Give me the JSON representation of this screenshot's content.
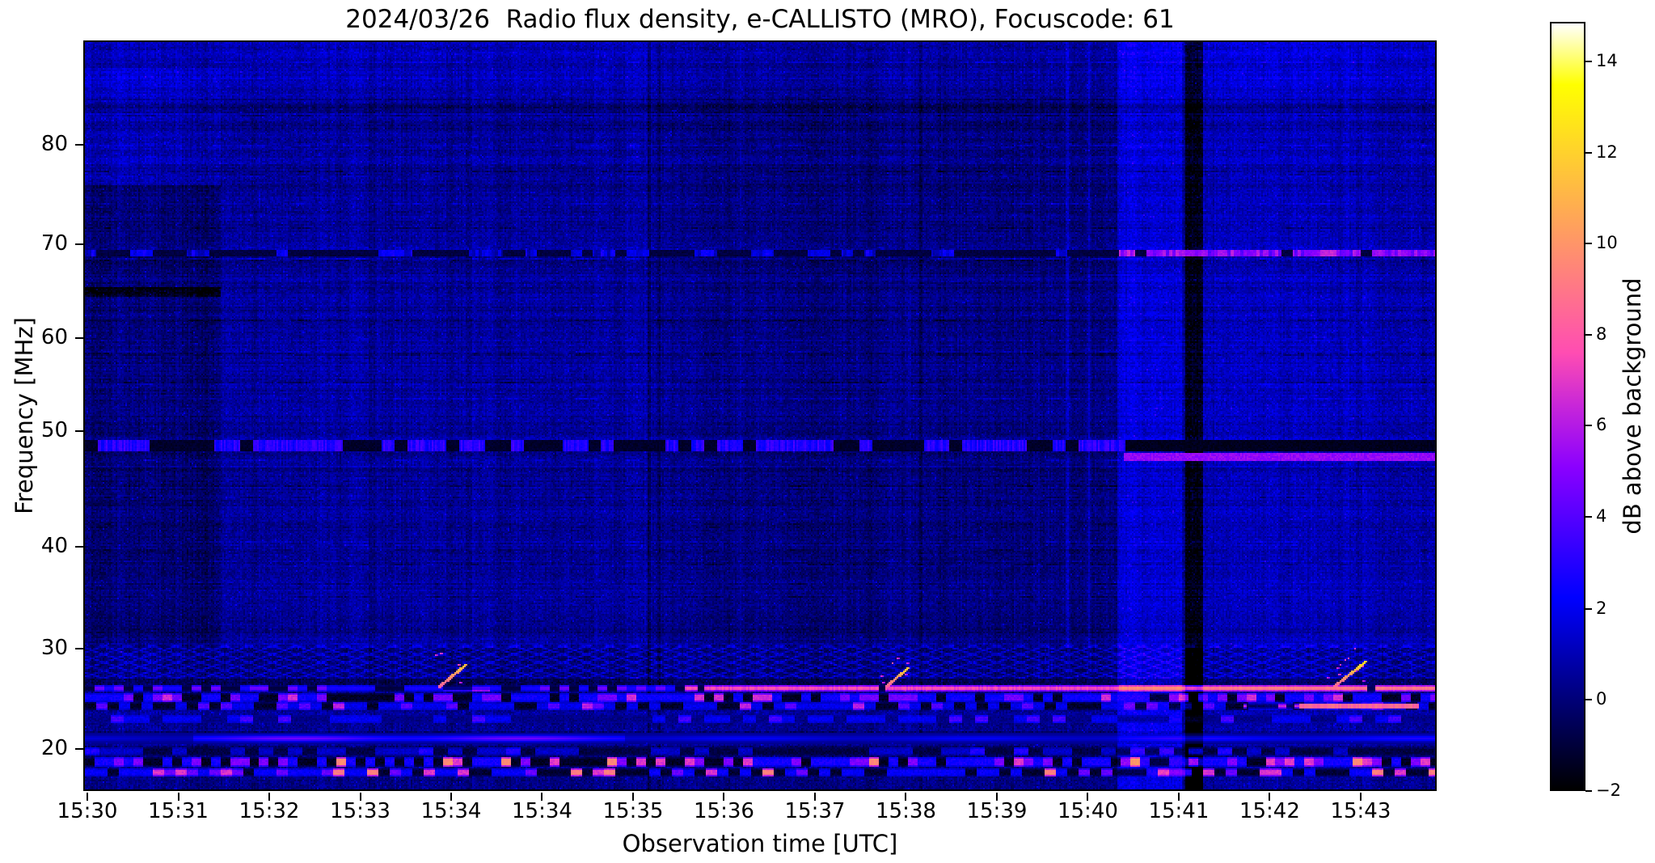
{
  "title": "2024/03/26  Radio flux density, e-CALLISTO (MRO), Focuscode: 61",
  "axes": {
    "xlabel": "Observation time [UTC]",
    "ylabel": "Frequency [MHz]",
    "x_ticks": [
      {
        "label": "15:30",
        "pos": 0.003
      },
      {
        "label": "15:31",
        "pos": 0.0702
      },
      {
        "label": "15:32",
        "pos": 0.1374
      },
      {
        "label": "15:33",
        "pos": 0.2046
      },
      {
        "label": "15:34",
        "pos": 0.2718
      },
      {
        "label": "15:34",
        "pos": 0.339
      },
      {
        "label": "15:35",
        "pos": 0.4062
      },
      {
        "label": "15:36",
        "pos": 0.4734
      },
      {
        "label": "15:37",
        "pos": 0.5406
      },
      {
        "label": "15:38",
        "pos": 0.6078
      },
      {
        "label": "15:39",
        "pos": 0.675
      },
      {
        "label": "15:40",
        "pos": 0.7422
      },
      {
        "label": "15:41",
        "pos": 0.8094
      },
      {
        "label": "15:42",
        "pos": 0.8766
      },
      {
        "label": "15:43",
        "pos": 0.9438
      }
    ],
    "y_ticks": [
      {
        "label": "80",
        "pos": 0.139
      },
      {
        "label": "70",
        "pos": 0.2716
      },
      {
        "label": "60",
        "pos": 0.3966
      },
      {
        "label": "50",
        "pos": 0.5205
      },
      {
        "label": "40",
        "pos": 0.6746
      },
      {
        "label": "30",
        "pos": 0.8103
      },
      {
        "label": "20",
        "pos": 0.944
      }
    ]
  },
  "colorbar": {
    "label": "dB above background",
    "vmin": -2,
    "vmax": 14.86,
    "colormap": "gnuplot2",
    "stops": [
      [
        0,
        "#000000"
      ],
      [
        0.125,
        "#000080"
      ],
      [
        0.25,
        "#0000ff"
      ],
      [
        0.35,
        "#5000ff"
      ],
      [
        0.42,
        "#8a00ff"
      ],
      [
        0.5,
        "#c726d9"
      ],
      [
        0.57,
        "#ff4db2"
      ],
      [
        0.65,
        "#ff7589"
      ],
      [
        0.75,
        "#ffa855"
      ],
      [
        0.85,
        "#ffdb23"
      ],
      [
        0.92,
        "#ffff00"
      ],
      [
        1,
        "#ffffff"
      ]
    ],
    "ticks": [
      {
        "label": "14",
        "pos": 0.051
      },
      {
        "label": "12",
        "pos": 0.17
      },
      {
        "label": "10",
        "pos": 0.288
      },
      {
        "label": "8",
        "pos": 0.407
      },
      {
        "label": "6",
        "pos": 0.525
      },
      {
        "label": "4",
        "pos": 0.644
      },
      {
        "label": "2",
        "pos": 0.763
      },
      {
        "label": "0",
        "pos": 0.881
      },
      {
        "label": "−2",
        "pos": 1.0
      }
    ]
  },
  "chart_data": {
    "type": "heatmap",
    "subtype": "radio-spectrogram",
    "title": "2024/03/26  Radio flux density, e-CALLISTO (MRO), Focuscode: 61",
    "date": "2024/03/26",
    "instrument": "e-CALLISTO (MRO)",
    "focuscode": 61,
    "xlabel": "Observation time [UTC]",
    "ylabel": "Frequency [MHz]",
    "x_range": [
      "15:30",
      "15:44"
    ],
    "y_range_mhz": [
      16.2,
      88.5
    ],
    "value_label": "dB above background",
    "value_range_db": [
      -2,
      15
    ],
    "x_tick_labels": [
      "15:30",
      "15:31",
      "15:32",
      "15:33",
      "15:34",
      "15:34",
      "15:35",
      "15:36",
      "15:37",
      "15:38",
      "15:39",
      "15:40",
      "15:41",
      "15:42",
      "15:43"
    ],
    "y_tick_values_mhz": [
      80,
      70,
      60,
      50,
      40,
      30,
      20
    ],
    "colorbar_tick_values_db": [
      14,
      12,
      10,
      8,
      6,
      4,
      2,
      0,
      -2
    ],
    "legend_position": "right-colorbar",
    "grid": false,
    "notable_features": [
      "Persistent narrow-band RFI line near 25.9 MHz; dashed before ~15:36, brightens to ~9–10.5 dB (orange) after ~15:36 and strongest after ~15:41",
      "Short upward-drifting bursts rising from the 26 MHz line near 15:34, 15:38.8 and 15:43.8 (up to ~13 dB)",
      "Dashed bright-blue RFI lane at ~48.6 MHz; becomes a solid dark lane with a bright violet sub-line after ~15:41",
      "Intermittent RFI line at ~69.3 MHz, dark with dashes on the left, bright violet dashes after ~15:41",
      "Receiver level step at ~15:31.5 (left segment darker 30–76 MHz, brighter 76–86 MHz)",
      "Bright vertical band ~15:40.8–15:41.2 followed by a near-black dropout stripe ~15:41.3",
      "Herringbone interference pattern 27–30 MHz; dash/morse RFI bands at 17–25.5 MHz; smooth glowing line near 20.8 MHz strongest 15:31–15:35",
      "Dark RFI notch at ~65 MHz visible only before 15:31.5; pink/salmon dash line near 24 MHz around 15:42.5–15:44"
    ],
    "render_model": {
      "seed": 7,
      "base_level": 0.35,
      "noise": {
        "pixel": 1.15,
        "col": [
          0.5,
          0.35,
          0.3
        ],
        "row_hi": 0.55,
        "row_lo": 0.18,
        "streak_prob": 0.2,
        "streak_amp": 2.2,
        "speckle_prob": 0.015,
        "speckle_add": 1.1
      },
      "freq_anchors": [
        [
          0,
          88.5
        ],
        [
          0.139,
          80
        ],
        [
          0.2716,
          70
        ],
        [
          0.3966,
          60
        ],
        [
          0.5205,
          50
        ],
        [
          0.6746,
          40
        ],
        [
          0.8103,
          30
        ],
        [
          0.944,
          20
        ],
        [
          1,
          16.2
        ]
      ],
      "boxes": [
        {
          "f": [
            30,
            76
          ],
          "t": [
            0,
            0.1
          ],
          "dv": -0.55
        },
        {
          "f": [
            76,
            86.5
          ],
          "t": [
            0,
            0.1
          ],
          "dv": 0.45
        },
        {
          "f": [
            30,
            88.5
          ],
          "t": [
            0.1,
            0.418
          ],
          "dv": 0.12
        },
        {
          "f": [
            30,
            88.5
          ],
          "t": [
            0.43,
            0.765
          ],
          "dv": -0.28
        },
        {
          "f": [
            15.9,
            88.5
          ],
          "t": [
            0.765,
            0.8125
          ],
          "dv": 1.1
        },
        {
          "f": [
            15.9,
            88.5
          ],
          "t": [
            0.8145,
            0.8275
          ],
          "dv": -1.9
        },
        {
          "f": [
            30,
            88.5
          ],
          "t": [
            0.8285,
            1
          ],
          "dv": 0.55
        },
        {
          "f": [
            15.9,
            30
          ],
          "t": [
            0.8285,
            1
          ],
          "dv": 0.3
        },
        {
          "f": [
            15.9,
            88.5
          ],
          "t": [
            0.417,
            0.4195
          ],
          "dv": -1.0
        },
        {
          "f": [
            15.9,
            88.5
          ],
          "t": [
            0.424,
            0.426
          ],
          "dv": -0.7
        },
        {
          "f": [
            15.9,
            88.5
          ],
          "t": [
            0.6175,
            0.6195
          ],
          "dv": -0.6
        },
        {
          "f": [
            15.9,
            88.5
          ],
          "t": [
            0.6355,
            0.6375
          ],
          "dv": -0.5
        },
        {
          "f": [
            30,
            88.5
          ],
          "t": [
            0.727,
            0.7285
          ],
          "dv": 0.9
        },
        {
          "f": [
            30,
            88.5
          ],
          "t": [
            0.743,
            0.7445
          ],
          "dv": 0.9
        },
        {
          "f": [
            84,
            88.5
          ],
          "t": [
            0,
            1
          ],
          "dv": 0.5
        },
        {
          "f": [
            64.5,
            65.5
          ],
          "t": [
            0,
            0.1
          ],
          "dv": -1.6
        },
        {
          "f": [
            82.8,
            83.6
          ],
          "t": [
            0,
            1
          ],
          "dv": -0.5
        },
        {
          "f": [
            26.3,
            26.9
          ],
          "t": [
            0,
            1
          ],
          "dv": -1.0
        },
        {
          "f": [
            22.3,
            23.5
          ],
          "t": [
            0,
            1
          ],
          "dv": 0.35
        },
        {
          "f": [
            19.1,
            20.1
          ],
          "t": [
            0,
            1
          ],
          "dv": -0.6
        },
        {
          "f": [
            15.9,
            17.3
          ],
          "t": [
            0,
            1
          ],
          "dv": -0.2
        }
      ],
      "post_boxes": [
        {
          "f": [
            15.9,
            30
          ],
          "t": [
            0.765,
            0.8125
          ],
          "dv": 0.5
        },
        {
          "f": [
            15.9,
            30
          ],
          "t": [
            0.8145,
            0.8275
          ],
          "dv": -1.6
        }
      ],
      "wave": {
        "f": [
          26.9,
          30.3
        ],
        "base": -0.55,
        "amp": 1.7,
        "kx": 0.42,
        "ky": 1.25
      },
      "line69": {
        "f": [
          68.9,
          69.6
        ],
        "base": -1.3,
        "t_split": 0.765,
        "dash_len": 7,
        "fill_left": 0.35,
        "amp_left": 2.6,
        "fill_right": 0.85,
        "amp_right": 6.0
      },
      "line48": {
        "f": [
          48.2,
          49.2
        ],
        "f_sub": [
          47.4,
          48.1
        ],
        "t_solid": 0.77,
        "dash_len": 8,
        "fill": 0.55,
        "dash_v": 2.6,
        "base": -1.65,
        "sub_v": 5.3
      },
      "rfi26": {
        "f": [
          25.55,
          26.25
        ],
        "t_dash": 0.44,
        "t_high": 0.765,
        "v_mid": 8.7,
        "v_high": 10.4,
        "dash_levels": [
          [
            0.3,
            -1.2
          ],
          [
            0.45,
            3.0
          ],
          [
            0.25,
            5.2
          ]
        ]
      },
      "bursts": [
        {
          "t": 0.262,
          "dx": 16,
          "dy": 13,
          "v": 12,
          "speckles": 5
        },
        {
          "t": 0.592,
          "dx": 13,
          "dy": 11,
          "v": 12.5,
          "speckles": 7
        },
        {
          "t": 0.925,
          "dx": 19,
          "dy": 15,
          "v": 13,
          "speckles": 10
        }
      ],
      "hlines": [
        {
          "f": [
            25.55,
            26.1
          ],
          "t": [
            0.265,
            0.3
          ],
          "v": 8.2
        },
        {
          "f": [
            23.8,
            24.25
          ],
          "t": [
            0.9,
            0.988
          ],
          "v": 8.4
        }
      ],
      "dashbands": [
        {
          "f": [
            24.5,
            25.45
          ],
          "t": [
            0,
            1
          ],
          "len": 6,
          "levels": [
            [
              0.3,
              -1.4
            ],
            [
              0.4,
              2.4
            ],
            [
              0.2,
              4.6
            ],
            [
              0.1,
              6.6
            ]
          ]
        },
        {
          "f": [
            23.6,
            24.4
          ],
          "t": [
            0,
            1
          ],
          "len": 7,
          "levels": [
            [
              0.35,
              -1.3
            ],
            [
              0.45,
              1.9
            ],
            [
              0.15,
              4.0
            ],
            [
              0.05,
              6.2
            ]
          ]
        },
        {
          "f": [
            23.8,
            24.3
          ],
          "t": [
            0.858,
            0.9
          ],
          "len": 5,
          "levels": [
            [
              0.5,
              -0.5
            ],
            [
              0.5,
              6.6
            ]
          ]
        },
        {
          "f": [
            22.4,
            23.1
          ],
          "t": [
            0,
            1
          ],
          "len": 8,
          "levels": [
            [
              0.45,
              0.2
            ],
            [
              0.4,
              2.0
            ],
            [
              0.15,
              3.6
            ]
          ]
        },
        {
          "f": [
            19.2,
            19.9
          ],
          "t": [
            0,
            1
          ],
          "len": 9,
          "levels": [
            [
              0.55,
              -0.9
            ],
            [
              0.35,
              1.3
            ],
            [
              0.1,
              2.8
            ]
          ]
        },
        {
          "f": [
            18.2,
            19.0
          ],
          "t": [
            0,
            1
          ],
          "len": 6,
          "levels": [
            [
              0.28,
              -1.4
            ],
            [
              0.38,
              2.6
            ],
            [
              0.2,
              4.8
            ],
            [
              0.09,
              7.0
            ],
            [
              0.05,
              9.6
            ]
          ]
        },
        {
          "f": [
            17.3,
            18.1
          ],
          "t": [
            0,
            1
          ],
          "len": 7,
          "levels": [
            [
              0.3,
              -1.2
            ],
            [
              0.4,
              2.2
            ],
            [
              0.18,
              4.4
            ],
            [
              0.08,
              6.8
            ],
            [
              0.04,
              9.2
            ]
          ]
        }
      ],
      "glow": {
        "f_center": 20.82,
        "sigma": 0.22,
        "segs": [
          [
            0,
            0.08,
            1.3
          ],
          [
            0.08,
            0.4,
            4.2
          ],
          [
            0.4,
            0.765,
            1.8
          ],
          [
            0.765,
            1,
            2.5
          ]
        ]
      },
      "blobs": {
        "f": [
          20.2,
          21.6
        ],
        "base": -0.7,
        "count": 26,
        "len": [
          12,
          34
        ],
        "dv": -1.35
      }
    }
  }
}
